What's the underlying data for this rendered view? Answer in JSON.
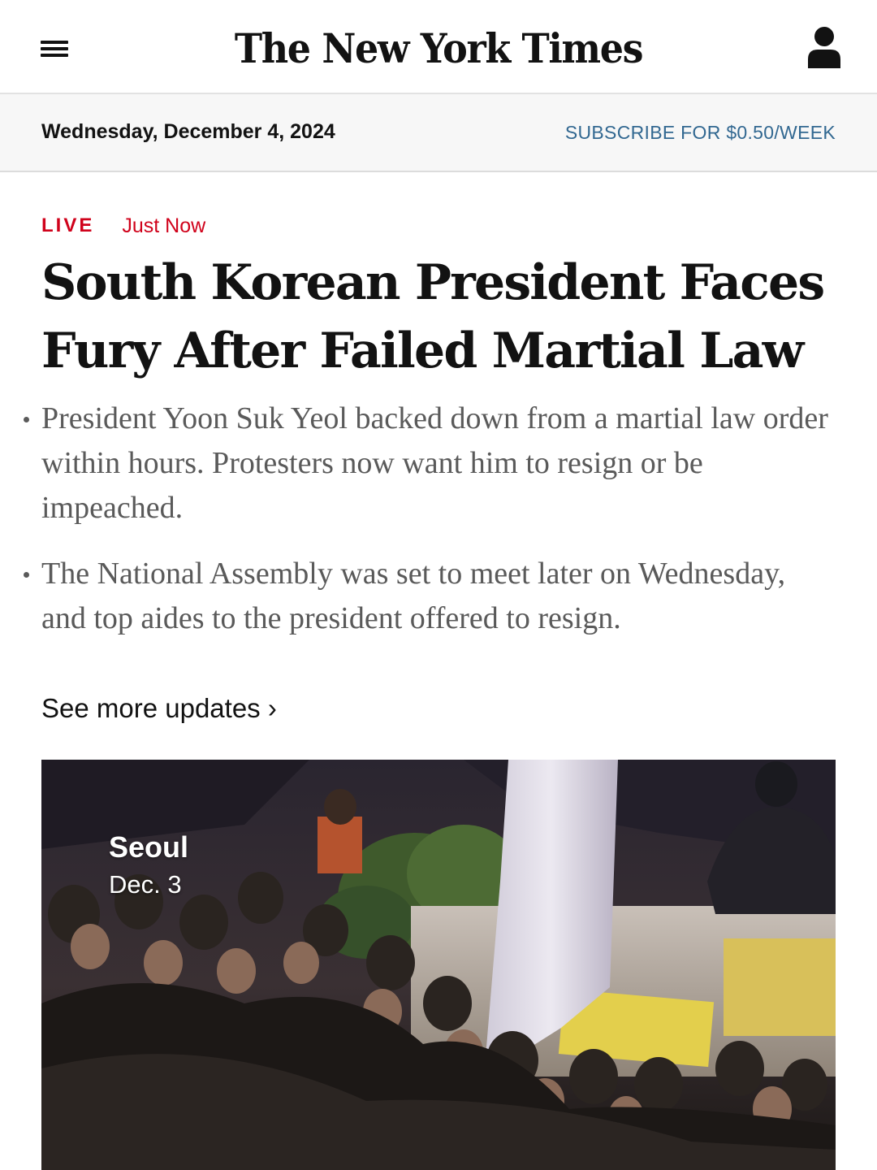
{
  "header": {
    "logo_text": "The New York Times",
    "menu_icon": "hamburger-menu-icon",
    "account_icon": "user-account-icon"
  },
  "datebar": {
    "date": "Wednesday, December 4, 2024",
    "subscribe_label": "SUBSCRIBE FOR $0.50/WEEK"
  },
  "article": {
    "live_label": "LIVE",
    "timestamp": "Just Now",
    "headline": "South Korean President Faces Fury After Failed Martial Law",
    "summary": [
      "President Yoon Suk Yeol backed down from a martial law order within hours. Protesters now want him to resign or be impeached.",
      "The National Assembly was set to meet later on Wednesday, and top aides to the president offered to resign."
    ],
    "more_link": "See more updates ›"
  },
  "media": {
    "place": "Seoul",
    "date": "Dec. 3"
  },
  "colors": {
    "live_red": "#d0021b",
    "subscribe_blue": "#326891",
    "summary_gray": "#5a5a5a",
    "date_bar_bg": "#f7f7f7"
  }
}
